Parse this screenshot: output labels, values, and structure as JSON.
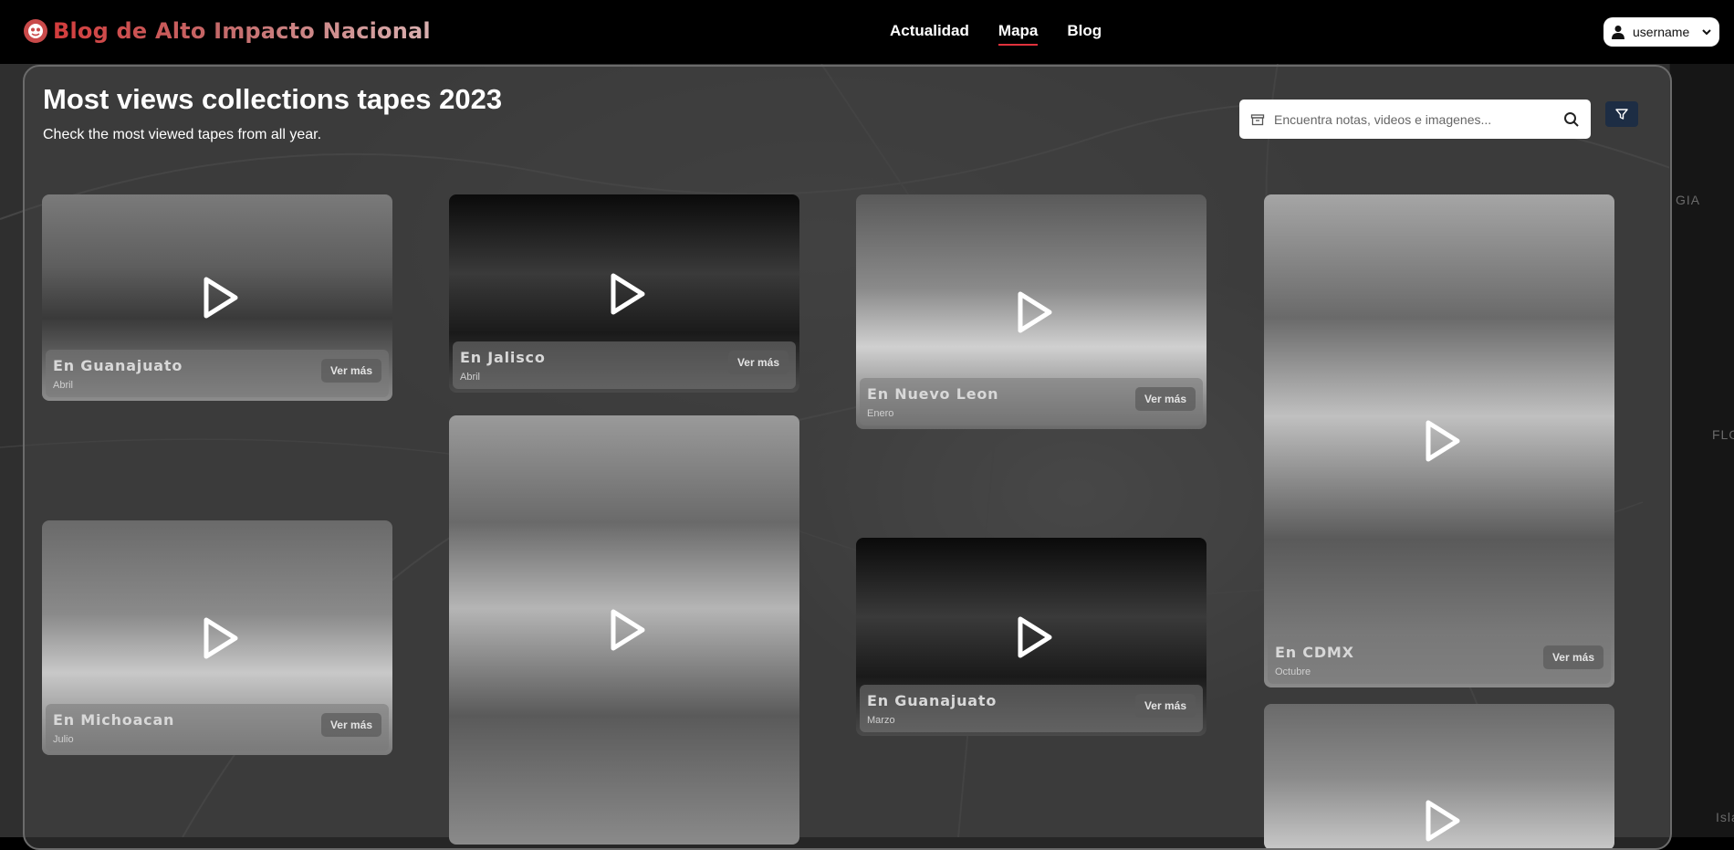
{
  "header": {
    "brand": "Blog de Alto Impacto Nacional",
    "nav": [
      {
        "label": "Actualidad",
        "active": false
      },
      {
        "label": "Mapa",
        "active": true
      },
      {
        "label": "Blog",
        "active": false
      }
    ],
    "user": {
      "name": "username",
      "icon": "user-icon",
      "dropdown_icon": "chevron-down-icon"
    }
  },
  "map_labels": [
    "GIA",
    "FLO",
    "Isla"
  ],
  "main": {
    "title": "Most views collections tapes 2023",
    "subtitle": "Check the most viewed tapes from all year.",
    "search": {
      "placeholder": "Encuentra notas, videos e imagenes...",
      "value": ""
    },
    "cards": [
      {
        "region": "En Guanajuato",
        "month": "Abril",
        "action": "Ver más"
      },
      {
        "region": "En Jalisco",
        "month": "Abril",
        "action": "Ver más"
      },
      {
        "region": "En Nuevo Leon",
        "month": "Enero",
        "action": "Ver más"
      },
      {
        "region": "En CDMX",
        "month": "Octubre",
        "action": "Ver más"
      },
      {
        "region": "En Michoacan",
        "month": "Julio",
        "action": "Ver más"
      },
      {
        "region": "",
        "month": "",
        "action": ""
      },
      {
        "region": "En Guanajuato",
        "month": "Marzo",
        "action": "Ver más"
      },
      {
        "region": "",
        "month": "",
        "action": ""
      }
    ]
  },
  "colors": {
    "accent": "#e0323c",
    "brand_red": "#d33c3c",
    "filter_button": "#1d2d44",
    "panel_border": "#6b6b6b"
  }
}
